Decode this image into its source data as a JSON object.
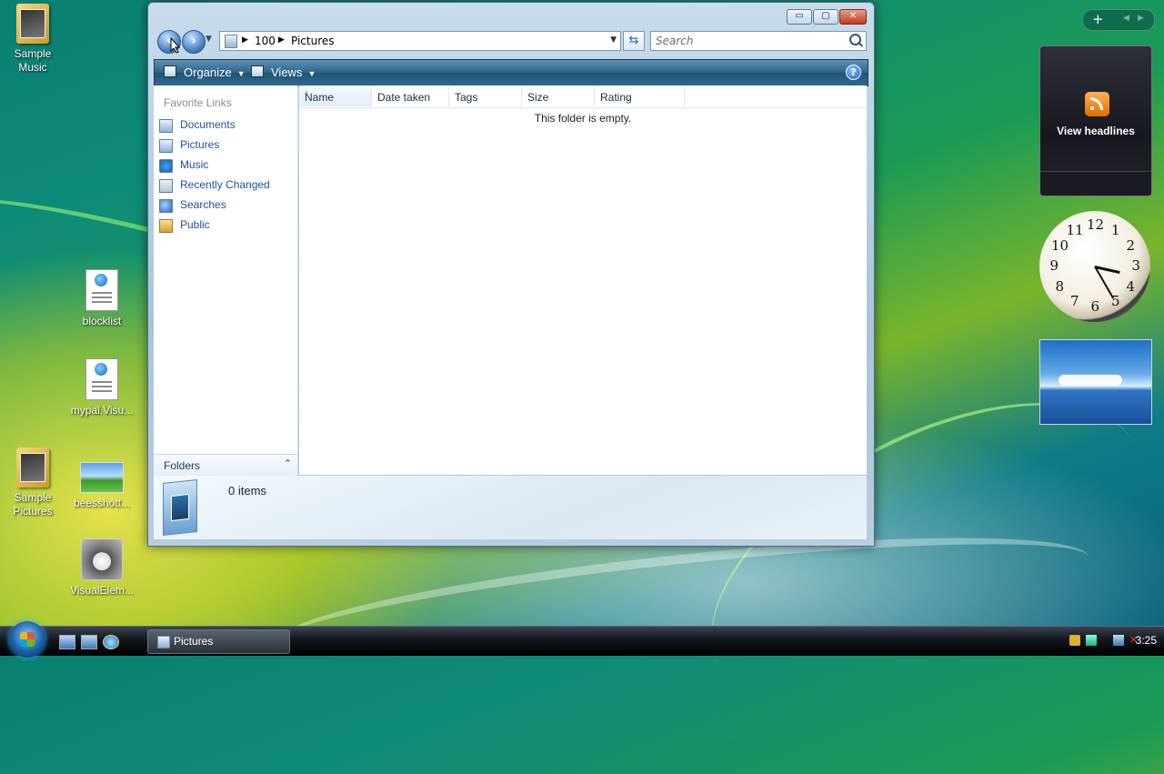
{
  "desktop": {
    "icons": [
      {
        "label": "Sample\nMusic"
      },
      {
        "label": "blocklist"
      },
      {
        "label": "mypal.Visu..."
      },
      {
        "label": "Sample\nPictures"
      },
      {
        "label": "beesshott..."
      },
      {
        "label": "VisualElem..."
      }
    ]
  },
  "window": {
    "title_buttons": {
      "minimize": "▭",
      "maximize": "▢",
      "close": "✕"
    },
    "address": {
      "root": "100",
      "current": "Pictures"
    },
    "search": {
      "placeholder": "Search"
    },
    "toolbar": {
      "organize": "Organize",
      "views": "Views",
      "help": "?"
    },
    "nav": {
      "heading": "Favorite Links",
      "links": [
        "Documents",
        "Pictures",
        "Music",
        "Recently Changed",
        "Searches",
        "Public"
      ],
      "folders_label": "Folders"
    },
    "columns": [
      "Name",
      "Date taken",
      "Tags",
      "Size",
      "Rating"
    ],
    "empty_message": "This folder is empty.",
    "details": {
      "item_count": "0 items"
    }
  },
  "sidebar": {
    "feed_text": "View headlines",
    "clock": {
      "hour": 3,
      "minute": 25,
      "numbers": [
        "12",
        "1",
        "2",
        "3",
        "4",
        "5",
        "6",
        "7",
        "8",
        "9",
        "10",
        "11"
      ]
    }
  },
  "taskbar": {
    "active_window": "Pictures",
    "time": "3:25"
  },
  "colors": {
    "accent": "#2c6386",
    "link": "#1e4f9c",
    "rss": "#f28a1c"
  }
}
